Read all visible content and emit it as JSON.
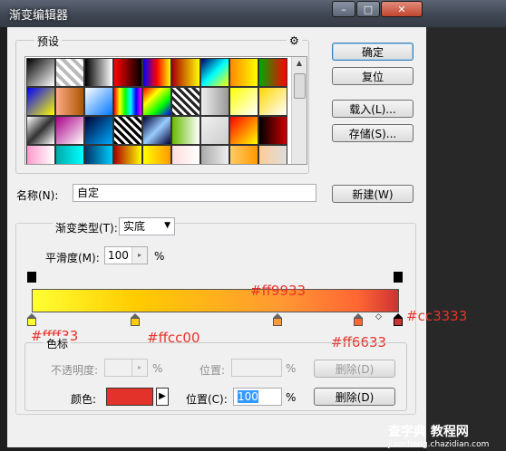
{
  "window": {
    "title": "渐变编辑器",
    "min": "–",
    "max": "□",
    "close": "✕"
  },
  "presets": {
    "label": "预设",
    "gear": "⚙"
  },
  "buttons": {
    "ok": "确定",
    "reset": "复位",
    "load": "载入(L)...",
    "save": "存储(S)...",
    "new": "新建(W)",
    "delete_top": "删除(D)",
    "delete_bottom": "删除(D)"
  },
  "name": {
    "label": "名称(N):",
    "value": "自定"
  },
  "gradient_type": {
    "label": "渐变类型(T):",
    "value": "实底"
  },
  "smoothness": {
    "label": "平滑度(M):",
    "value": "100",
    "unit": "%"
  },
  "stops_group": {
    "label": "色标"
  },
  "opacity": {
    "label": "不透明度:",
    "unit": "%",
    "pos_label": "位置:",
    "pos_unit": "%"
  },
  "color": {
    "label": "颜色:",
    "swatch": "#e2322a",
    "pos_label": "位置(C):",
    "pos_value": "100",
    "pos_unit": "%"
  },
  "gradient": {
    "colors": [
      "#ffff33",
      "#ffcc00",
      "#ff9933",
      "#ff6633",
      "#cc3333"
    ]
  },
  "annotations": {
    "a1": "#ffff33",
    "a2": "#ffcc00",
    "a3": "#ff9933",
    "a4": "#ff6633",
    "a5": "#cc3333"
  },
  "watermark": {
    "big": "查字典 教程网",
    "small": "jiaocheng.chazidian.com"
  },
  "swatches": [
    "linear-gradient(135deg,#000,#fff)",
    "repeating-linear-gradient(45deg,#bbb 0 4px,#fff 4px 8px)",
    "linear-gradient(90deg,#000,#fff)",
    "linear-gradient(90deg,#f00,#000)",
    "linear-gradient(90deg,#00f,#f00,#ff0)",
    "linear-gradient(90deg,#a00,#ff0)",
    "linear-gradient(135deg,#006,#0ff,#ff0)",
    "linear-gradient(90deg,#f80,#ff0)",
    "linear-gradient(90deg,#0a0,#f00)",
    "linear-gradient(135deg,#00f,#ff0)",
    "linear-gradient(90deg,#fa8,#a50)",
    "linear-gradient(135deg,#fff,#0077ff)",
    "linear-gradient(90deg,#f00,#ff0,#0f0,#0ff,#00f,#f0f)",
    "linear-gradient(135deg,#f00,#ff0,#0f0,#00f)",
    "repeating-linear-gradient(45deg,#222 0 3px,#fff 3px 6px)",
    "linear-gradient(90deg,#eee,#999)",
    "linear-gradient(135deg,#ff0,#fff)",
    "linear-gradient(135deg,#ffd700,#fff)",
    "linear-gradient(135deg,#fff,#333,#fff)",
    "linear-gradient(135deg,#a08,#fff)",
    "linear-gradient(135deg,#003,#0af)",
    "repeating-linear-gradient(45deg,#000 0 3px,#fff 3px 6px)",
    "linear-gradient(135deg,#003,#9cf,#003)",
    "linear-gradient(90deg,#6b0,#fff)",
    "linear-gradient(135deg,#f0f0f0,#ccc)",
    "linear-gradient(135deg,#f00,#ff0)",
    "linear-gradient(90deg,#000,#c00)",
    "linear-gradient(90deg,#f9c,#fff)",
    "linear-gradient(90deg,#0aa,#0ff)",
    "linear-gradient(90deg,#036,#0cf)",
    "linear-gradient(90deg,#a00,#ff0)",
    "linear-gradient(90deg,#ff0,#f90)",
    "linear-gradient(90deg,#fdd,#fff)",
    "linear-gradient(90deg,#aaa,#eee)",
    "linear-gradient(90deg,#fc6,#f90)",
    "linear-gradient(90deg,#fc9,#ddd)"
  ]
}
